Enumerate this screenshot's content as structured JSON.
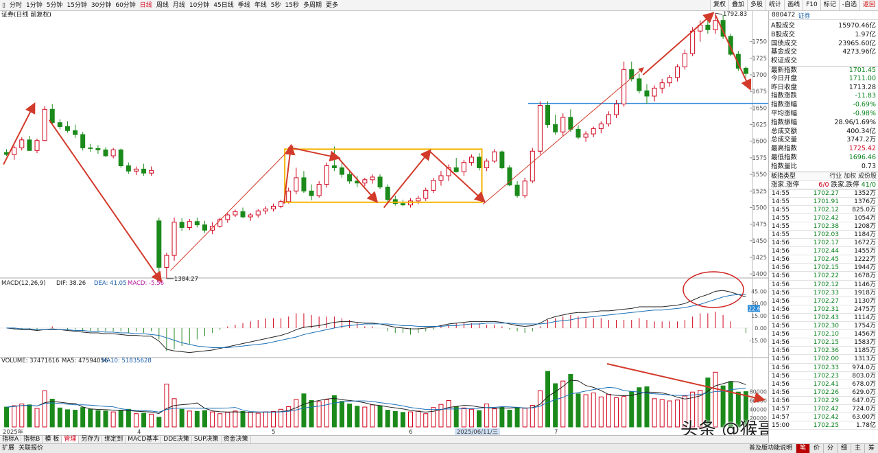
{
  "toolbar": {
    "left_icon": "▯",
    "periods": [
      "分时",
      "1分钟",
      "5分钟",
      "15分钟",
      "30分钟",
      "60分钟",
      "日线",
      "周线",
      "月线",
      "10分钟",
      "45日线",
      "季线",
      "年线",
      "5秒",
      "15秒",
      "多周期",
      "更多"
    ],
    "active_period": "日线",
    "buttons": [
      "复权",
      "叠加",
      "多股",
      "统计",
      "画线",
      "F10",
      "标记",
      "-自选",
      "返回"
    ]
  },
  "chart_header": {
    "index_label": "证券(日线 前复权)",
    "macd_title": "MACD(12,26,9)",
    "macd_dif": "DIF: 38.26",
    "macd_dea": "DEA: 41.05",
    "macd_value": "MACD: -5.56",
    "volume_title": "VOLUME: 37471616",
    "volume_ma5": "MA5: 47594056",
    "volume_ma10": "MA10: 51835628"
  },
  "watermark": "头条 @猴哥聊缠论",
  "chart_data": {
    "type": "candlestick",
    "price_axis": {
      "min": 1395,
      "max": 1790,
      "ticks": [
        1400,
        1425,
        1450,
        1475,
        1500,
        1525,
        1550,
        1575,
        1600,
        1625,
        1650,
        1675,
        1700,
        1725,
        1750
      ]
    },
    "annotations": {
      "high_label": "1792.83",
      "low_label": "1384.27",
      "macd_marker": "22.6"
    },
    "x_labels": [
      "2025年",
      "4",
      "5",
      "6",
      "2025/06/11/三",
      "7"
    ],
    "horizontal_line": 1657,
    "candles": [
      [
        1583,
        1588,
        1578,
        1580
      ],
      [
        1580,
        1593,
        1572,
        1590
      ],
      [
        1590,
        1606,
        1586,
        1602
      ],
      [
        1602,
        1608,
        1588,
        1586
      ],
      [
        1586,
        1604,
        1582,
        1601
      ],
      [
        1601,
        1653,
        1600,
        1648
      ],
      [
        1648,
        1656,
        1625,
        1628
      ],
      [
        1628,
        1633,
        1618,
        1622
      ],
      [
        1622,
        1630,
        1613,
        1616
      ],
      [
        1616,
        1625,
        1605,
        1610
      ],
      [
        1610,
        1614,
        1586,
        1590
      ],
      [
        1590,
        1596,
        1584,
        1589
      ],
      [
        1589,
        1594,
        1581,
        1587
      ],
      [
        1587,
        1591,
        1576,
        1578
      ],
      [
        1578,
        1590,
        1574,
        1587
      ],
      [
        1587,
        1589,
        1560,
        1563
      ],
      [
        1563,
        1568,
        1551,
        1555
      ],
      [
        1555,
        1562,
        1549,
        1558
      ],
      [
        1558,
        1566,
        1548,
        1552
      ],
      [
        1552,
        1562,
        1548,
        1556
      ],
      [
        1480,
        1485,
        1400,
        1410
      ],
      [
        1410,
        1432,
        1393,
        1428
      ],
      [
        1428,
        1485,
        1420,
        1478
      ],
      [
        1478,
        1484,
        1465,
        1470
      ],
      [
        1470,
        1483,
        1466,
        1479
      ],
      [
        1479,
        1485,
        1470,
        1474
      ],
      [
        1474,
        1480,
        1462,
        1466
      ],
      [
        1466,
        1478,
        1460,
        1472
      ],
      [
        1472,
        1485,
        1470,
        1482
      ],
      [
        1482,
        1492,
        1477,
        1489
      ],
      [
        1489,
        1497,
        1486,
        1494
      ],
      [
        1494,
        1500,
        1484,
        1486
      ],
      [
        1486,
        1492,
        1480,
        1489
      ],
      [
        1489,
        1498,
        1485,
        1495
      ],
      [
        1495,
        1502,
        1490,
        1498
      ],
      [
        1498,
        1506,
        1494,
        1502
      ],
      [
        1502,
        1512,
        1499,
        1509
      ],
      [
        1509,
        1530,
        1506,
        1525
      ],
      [
        1525,
        1560,
        1520,
        1545
      ],
      [
        1545,
        1555,
        1522,
        1525
      ],
      [
        1525,
        1535,
        1511,
        1518
      ],
      [
        1518,
        1540,
        1515,
        1535
      ],
      [
        1535,
        1568,
        1530,
        1563
      ],
      [
        1563,
        1592,
        1555,
        1560
      ],
      [
        1560,
        1570,
        1545,
        1550
      ],
      [
        1550,
        1556,
        1536,
        1540
      ],
      [
        1540,
        1548,
        1531,
        1537
      ],
      [
        1537,
        1545,
        1532,
        1542
      ],
      [
        1542,
        1550,
        1536,
        1546
      ],
      [
        1546,
        1550,
        1528,
        1531
      ],
      [
        1531,
        1535,
        1509,
        1512
      ],
      [
        1512,
        1518,
        1503,
        1506
      ],
      [
        1506,
        1512,
        1502,
        1504
      ],
      [
        1504,
        1514,
        1500,
        1510
      ],
      [
        1510,
        1518,
        1505,
        1514
      ],
      [
        1514,
        1530,
        1510,
        1526
      ],
      [
        1526,
        1545,
        1522,
        1541
      ],
      [
        1541,
        1555,
        1533,
        1548
      ],
      [
        1548,
        1565,
        1540,
        1560
      ],
      [
        1560,
        1575,
        1553,
        1554
      ],
      [
        1554,
        1572,
        1548,
        1568
      ],
      [
        1568,
        1580,
        1563,
        1576
      ],
      [
        1576,
        1582,
        1556,
        1560
      ],
      [
        1560,
        1574,
        1555,
        1570
      ],
      [
        1570,
        1588,
        1567,
        1584
      ],
      [
        1584,
        1586,
        1558,
        1560
      ],
      [
        1560,
        1564,
        1532,
        1534
      ],
      [
        1534,
        1540,
        1515,
        1518
      ],
      [
        1518,
        1545,
        1514,
        1540
      ],
      [
        1540,
        1590,
        1537,
        1585
      ],
      [
        1585,
        1660,
        1580,
        1654
      ],
      [
        1654,
        1660,
        1620,
        1625
      ],
      [
        1625,
        1640,
        1610,
        1614
      ],
      [
        1614,
        1642,
        1608,
        1636
      ],
      [
        1636,
        1648,
        1614,
        1618
      ],
      [
        1618,
        1624,
        1603,
        1606
      ],
      [
        1606,
        1615,
        1599,
        1611
      ],
      [
        1611,
        1622,
        1606,
        1619
      ],
      [
        1619,
        1630,
        1612,
        1626
      ],
      [
        1626,
        1645,
        1622,
        1640
      ],
      [
        1640,
        1662,
        1635,
        1656
      ],
      [
        1656,
        1720,
        1652,
        1708
      ],
      [
        1708,
        1720,
        1690,
        1694
      ],
      [
        1694,
        1702,
        1672,
        1676
      ],
      [
        1676,
        1686,
        1656,
        1668
      ],
      [
        1668,
        1684,
        1660,
        1680
      ],
      [
        1680,
        1694,
        1672,
        1688
      ],
      [
        1688,
        1700,
        1682,
        1696
      ],
      [
        1696,
        1716,
        1690,
        1712
      ],
      [
        1712,
        1738,
        1708,
        1732
      ],
      [
        1732,
        1772,
        1728,
        1766
      ],
      [
        1766,
        1782,
        1750,
        1775
      ],
      [
        1775,
        1788,
        1762,
        1768
      ],
      [
        1768,
        1793,
        1762,
        1782
      ],
      [
        1782,
        1790,
        1754,
        1758
      ],
      [
        1758,
        1762,
        1728,
        1731
      ],
      [
        1731,
        1736,
        1706,
        1710
      ],
      [
        1710,
        1713,
        1696,
        1702
      ]
    ],
    "volumes": [
      45,
      48,
      52,
      50,
      42,
      82,
      63,
      43,
      39,
      38,
      44,
      40,
      37,
      36,
      34,
      38,
      40,
      30,
      31,
      29,
      22,
      97,
      64,
      40,
      36,
      35,
      37,
      34,
      30,
      33,
      36,
      35,
      33,
      31,
      34,
      35,
      40,
      46,
      62,
      75,
      60,
      57,
      62,
      71,
      58,
      52,
      47,
      45,
      50,
      48,
      38,
      35,
      33,
      34,
      36,
      30,
      44,
      51,
      60,
      46,
      43,
      40,
      37,
      52,
      41,
      45,
      38,
      44,
      43,
      49,
      82,
      126,
      98,
      104,
      119,
      75,
      73,
      77,
      68,
      74,
      66,
      69,
      80,
      89,
      91,
      64,
      62,
      59,
      61,
      70,
      79,
      83,
      111,
      124,
      93,
      103,
      79,
      80
    ],
    "dif": [
      0,
      -1,
      -2,
      -2,
      -3,
      -2,
      -1,
      -2,
      -3,
      -4,
      -5,
      -6,
      -6,
      -7,
      -7,
      -8,
      -9,
      -9,
      -10,
      -10,
      -16,
      -26,
      -28,
      -29,
      -30,
      -29,
      -28,
      -27,
      -25,
      -23,
      -21,
      -19,
      -17,
      -15,
      -13,
      -11,
      -9,
      -6,
      -2,
      1,
      2,
      3,
      5,
      7,
      8,
      8,
      7,
      6,
      6,
      5,
      3,
      1,
      0,
      -1,
      -1,
      0,
      1,
      3,
      5,
      6,
      7,
      8,
      8,
      8,
      8,
      7,
      5,
      3,
      2,
      3,
      6,
      11,
      14,
      16,
      18,
      19,
      19,
      20,
      21,
      21,
      22,
      23,
      24,
      26,
      26,
      26,
      26,
      27,
      28,
      30,
      34,
      38,
      41,
      45,
      46,
      44,
      41,
      38
    ],
    "dea": [
      0,
      0,
      -1,
      -1,
      -2,
      -2,
      -2,
      -2,
      -2,
      -3,
      -3,
      -4,
      -4,
      -5,
      -5,
      -6,
      -6,
      -7,
      -7,
      -8,
      -9,
      -12,
      -15,
      -18,
      -20,
      -22,
      -23,
      -24,
      -24,
      -24,
      -23,
      -22,
      -21,
      -20,
      -19,
      -17,
      -15,
      -13,
      -11,
      -8,
      -6,
      -4,
      -2,
      0,
      2,
      3,
      4,
      5,
      5,
      5,
      5,
      4,
      3,
      3,
      2,
      2,
      2,
      2,
      3,
      3,
      4,
      5,
      5,
      6,
      6,
      6,
      6,
      5,
      5,
      5,
      5,
      6,
      8,
      9,
      10,
      12,
      13,
      14,
      15,
      16,
      17,
      18,
      19,
      20,
      21,
      22,
      22,
      23,
      24,
      25,
      27,
      29,
      32,
      35,
      38,
      40,
      41,
      41
    ]
  },
  "right_panel": {
    "code": "880472",
    "name": "证券",
    "stats": [
      {
        "label": "A股成交",
        "value": "15970.46亿",
        "color": "black"
      },
      {
        "label": "B股成交",
        "value": "1.97亿",
        "color": "black"
      },
      {
        "label": "国债成交",
        "value": "23965.60亿",
        "color": "black"
      },
      {
        "label": "基金成交",
        "value": "4273.96亿",
        "color": "black"
      },
      {
        "label": "权证成交",
        "value": "",
        "color": "black"
      },
      {
        "label": "最新指数",
        "value": "1701.45",
        "color": "green"
      },
      {
        "label": "今日开盘",
        "value": "1711.00",
        "color": "green"
      },
      {
        "label": "昨日收盘",
        "value": "1713.28",
        "color": "black"
      },
      {
        "label": "指数涨跌",
        "value": "-11.83",
        "color": "green"
      },
      {
        "label": "指数涨幅",
        "value": "-0.69%",
        "color": "green"
      },
      {
        "label": "平均涨幅",
        "value": "-0.98%",
        "color": "green"
      },
      {
        "label": "指数振幅",
        "value": "28.96/1.69%",
        "color": "black"
      },
      {
        "label": "总成交额",
        "value": "400.34亿",
        "color": "black"
      },
      {
        "label": "总成交量",
        "value": "3747.2万",
        "color": "black"
      },
      {
        "label": "最高指数",
        "value": "1725.42",
        "color": "red"
      },
      {
        "label": "最低指数",
        "value": "1696.46",
        "color": "green"
      },
      {
        "label": "指数量比",
        "value": "0.73",
        "color": "black"
      }
    ],
    "sector_label": "板指类型",
    "sector_links": "行业 加权 成份股",
    "limit_label": "涨家.涨停",
    "limit_up": "6/0",
    "limit_down_label": " 跌家.跌停 ",
    "limit_down": "41/0",
    "ticks": [
      {
        "time": "14:55",
        "price": "1702.27",
        "vol": "1352万"
      },
      {
        "time": "14:55",
        "price": "1701.91",
        "vol": "1376万"
      },
      {
        "time": "14:55",
        "price": "1702.12",
        "vol": "825.0万"
      },
      {
        "time": "14:55",
        "price": "1702.42",
        "vol": "1054万"
      },
      {
        "time": "14:55",
        "price": "1702.38",
        "vol": "1208万"
      },
      {
        "time": "14:55",
        "price": "1702.03",
        "vol": "1184万"
      },
      {
        "time": "14:56",
        "price": "1702.17",
        "vol": "1672万"
      },
      {
        "time": "14:56",
        "price": "1702.44",
        "vol": "1455万"
      },
      {
        "time": "14:56",
        "price": "1702.45",
        "vol": "1222万"
      },
      {
        "time": "14:56",
        "price": "1702.15",
        "vol": "1944万"
      },
      {
        "time": "14:56",
        "price": "1702.22",
        "vol": "1678万"
      },
      {
        "time": "14:56",
        "price": "1702.12",
        "vol": "1146万"
      },
      {
        "time": "14:56",
        "price": "1702.33",
        "vol": "1918万"
      },
      {
        "time": "14:56",
        "price": "1702.27",
        "vol": "1130万"
      },
      {
        "time": "14:56",
        "price": "1702.31",
        "vol": "2475万"
      },
      {
        "time": "14:56",
        "price": "1702.43",
        "vol": "1114万"
      },
      {
        "time": "14:56",
        "price": "1702.30",
        "vol": "1754万"
      },
      {
        "time": "14:56",
        "price": "1702.10",
        "vol": "1456万"
      },
      {
        "time": "14:56",
        "price": "1702.15",
        "vol": "1583万"
      },
      {
        "time": "14:56",
        "price": "1702.36",
        "vol": "1185万"
      },
      {
        "time": "14:56",
        "price": "1702.00",
        "vol": "1313万"
      },
      {
        "time": "14:56",
        "price": "1702.33",
        "vol": "974.0万"
      },
      {
        "time": "14:56",
        "price": "1702.23",
        "vol": "803.0万"
      },
      {
        "time": "14:56",
        "price": "1702.41",
        "vol": "678.0万"
      },
      {
        "time": "14:56",
        "price": "1702.26",
        "vol": "629.0万"
      },
      {
        "time": "14:56",
        "price": "1702.29",
        "vol": "647.0万"
      },
      {
        "time": "14:57",
        "price": "1702.42",
        "vol": "724.0万"
      },
      {
        "time": "14:57",
        "price": "1702.42",
        "vol": "63.00万"
      },
      {
        "time": "15:00",
        "price": "1702.25",
        "vol": "1.78亿"
      }
    ]
  },
  "bottom_tabs": [
    "指标A",
    "指标B",
    "模 板",
    "管理",
    "另存为",
    "绑定到",
    "MACD基本",
    "DDE决策",
    "SUP决策",
    "资金决策"
  ],
  "active_bottom_tab": "管理",
  "status_bar": {
    "items": [
      "扩展",
      "关联报价"
    ],
    "help": "普及版功能说明",
    "buttons": [
      "笔",
      "价",
      "分",
      "细",
      "主",
      "筹"
    ],
    "active_button": "笔"
  }
}
